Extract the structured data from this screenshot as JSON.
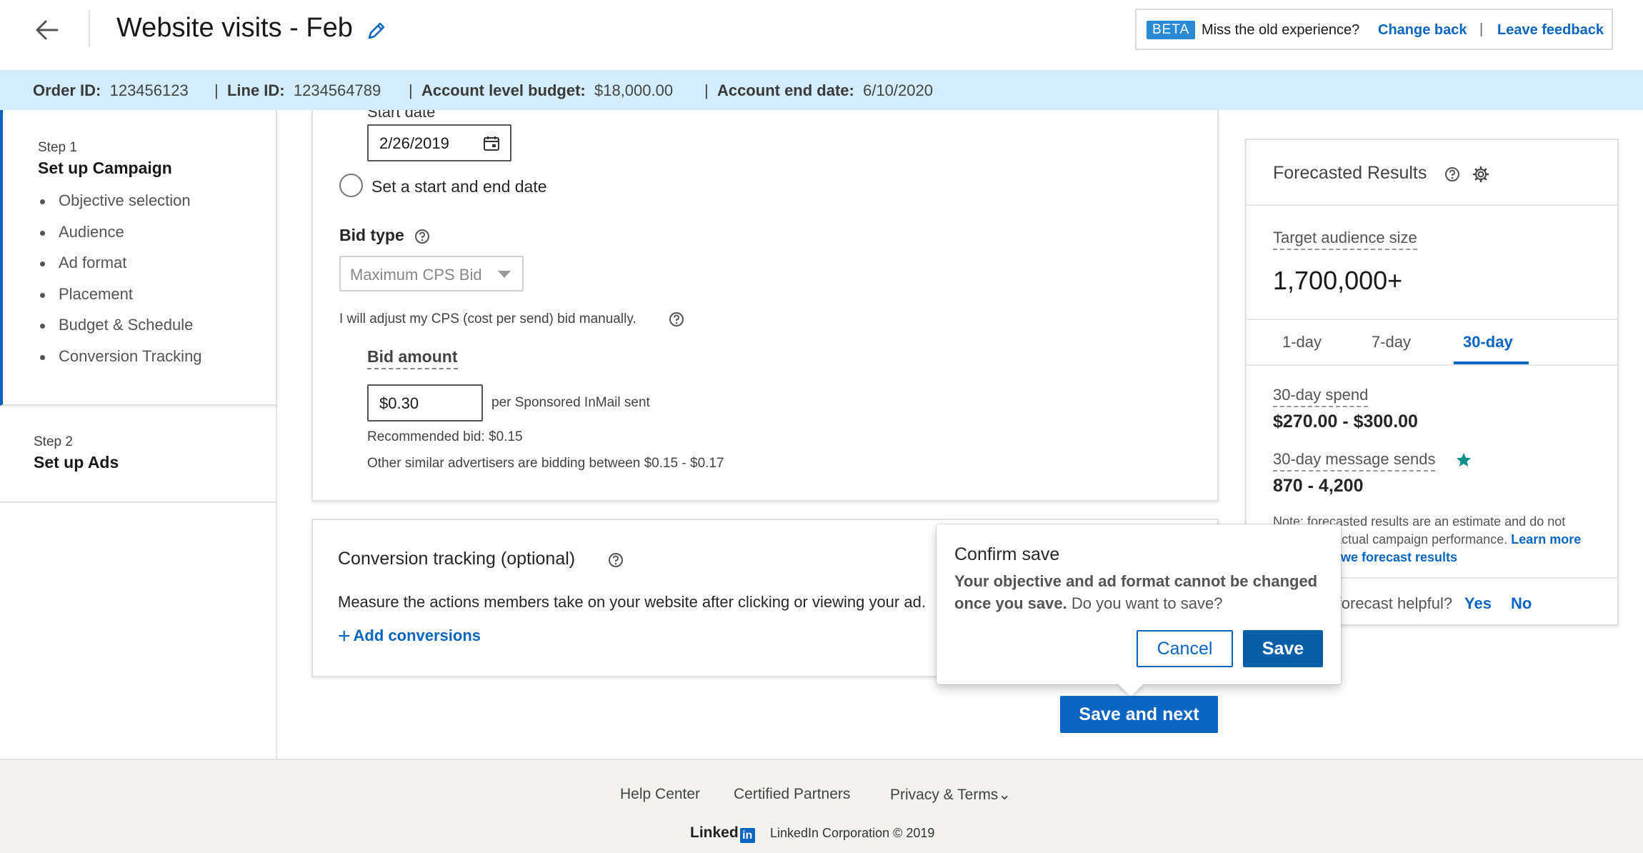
{
  "header": {
    "title": "Website visits - Feb",
    "beta_badge": "BETA",
    "beta_text": "Miss the old experience?",
    "change_back": "Change back",
    "separator": "|",
    "leave_feedback": "Leave feedback"
  },
  "info_bar": {
    "order_id_label": "Order ID:",
    "order_id": "123456123",
    "line_id_label": "Line ID:",
    "line_id": "1234564789",
    "budget_label": "Account level budget:",
    "budget": "$18,000.00",
    "end_date_label": "Account end date:",
    "end_date": "6/10/2020",
    "separator": "|"
  },
  "sidebar": {
    "step1_label": "Step 1",
    "step1_title": "Set up Campaign",
    "items": [
      "Objective selection",
      "Audience",
      "Ad format",
      "Placement",
      "Budget & Schedule",
      "Conversion Tracking"
    ],
    "step2_label": "Step 2",
    "step2_title": "Set up Ads"
  },
  "schedule": {
    "start_date_label": "Start date",
    "start_date_value": "2/26/2019",
    "radio_label": "Set a start and end date"
  },
  "bid": {
    "type_label": "Bid type",
    "select_value": "Maximum CPS Bid",
    "hint": "I will adjust my CPS (cost per send) bid manually.",
    "amount_label": "Bid amount",
    "amount_value": "$0.30",
    "per_label": "per Sponsored InMail sent",
    "recommended": "Recommended bid: $0.15",
    "similar": "Other similar advertisers are bidding between $0.15 - $0.17"
  },
  "conversion": {
    "title": "Conversion tracking (optional)",
    "description": "Measure the actions members take on your website after clicking or viewing your ad.",
    "add_icon": "+",
    "add_label": "Add conversions"
  },
  "forecast": {
    "title": "Forecasted Results",
    "audience_label": "Target audience size",
    "audience_value": "1,700,000+",
    "tabs": [
      "1-day",
      "7-day",
      "30-day"
    ],
    "active_tab": "30-day",
    "spend_label": "30-day spend",
    "spend_value": "$270.00 - $300.00",
    "sends_label": "30-day message sends",
    "sends_value": "870 - 4,200",
    "note": "Note: forecasted results are an estimate and do not guarantee actual campaign performance.",
    "note_link": "Learn more about how we forecast results",
    "helpful": "Was this forecast helpful?",
    "yes": "Yes",
    "no": "No"
  },
  "popover": {
    "title": "Confirm save",
    "message_bold": "Your objective and ad format cannot be changed once you save.",
    "message_rest": " Do you want to save?",
    "cancel": "Cancel",
    "save": "Save"
  },
  "save_next": "Save and next",
  "footer": {
    "help": "Help Center",
    "partners": "Certified Partners",
    "privacy": "Privacy & Terms",
    "privacy_caret": "⌄",
    "logo_text": "Linked",
    "logo_in": "in",
    "copyright": "LinkedIn Corporation © 2019"
  },
  "icons": {
    "back": "back-arrow-icon",
    "edit": "pencil-icon",
    "calendar": "calendar-icon",
    "help": "question-circle-icon",
    "settings": "gear-icon",
    "star": "star-icon"
  },
  "colors": {
    "accent": "#0a66c2",
    "info_bar": "#d4ecfb",
    "beta_badge": "#2a8ad8",
    "star": "#0f8f8a"
  }
}
